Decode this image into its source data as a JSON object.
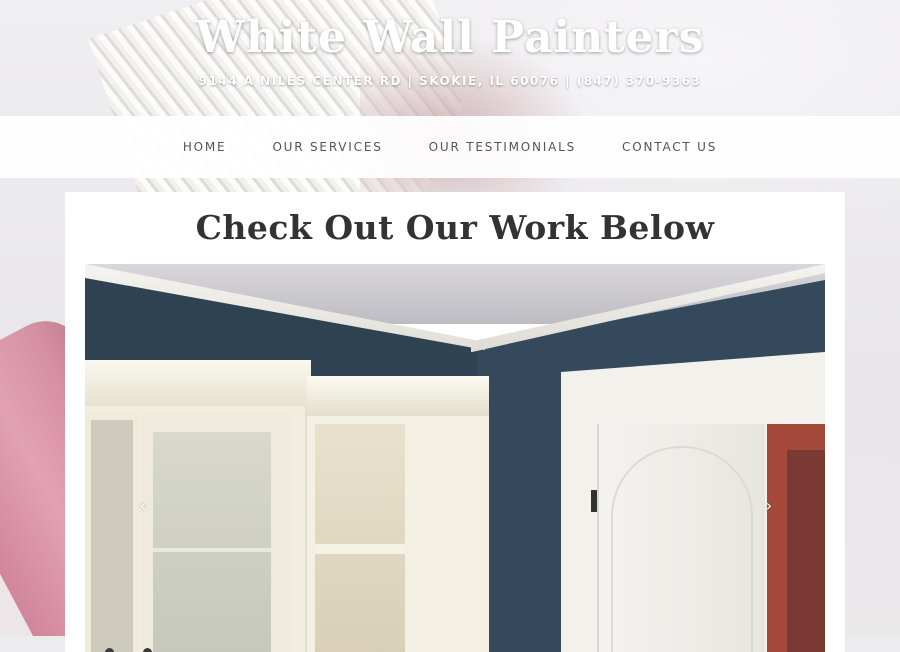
{
  "header": {
    "title": "White Wall Painters",
    "address": "9144 A NILES CENTER RD | SKOKIE, IL 60076 | (847) 370-9363"
  },
  "nav": {
    "items": [
      {
        "label": "HOME"
      },
      {
        "label": "OUR SERVICES"
      },
      {
        "label": "OUR TESTIMONIALS"
      },
      {
        "label": "CONTACT US"
      }
    ]
  },
  "main": {
    "heading": "Check Out Our Work Below",
    "slider": {
      "prev_icon": "chevron-left-icon",
      "next_icon": "chevron-right-icon",
      "prev_glyph": "‹",
      "next_glyph": "›"
    }
  },
  "colors": {
    "title_text": "#ffffff",
    "nav_text": "#555555",
    "heading_text": "#333333",
    "wall_paint": "#2f4252"
  }
}
